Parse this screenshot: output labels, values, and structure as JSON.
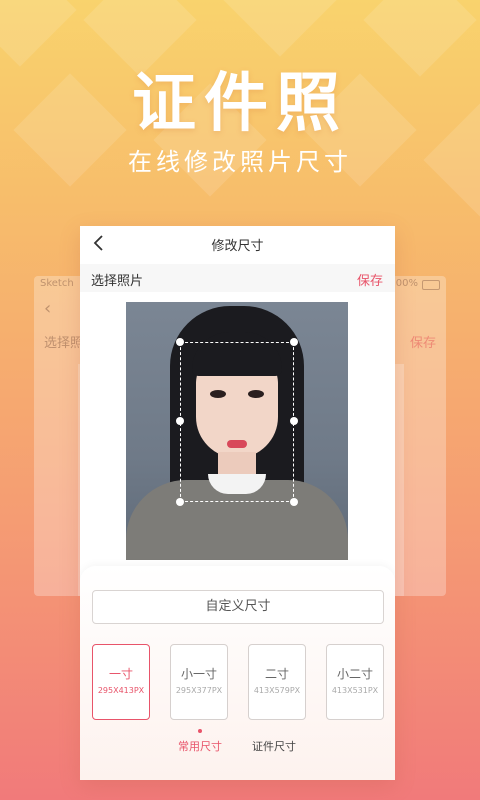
{
  "hero": {
    "title": "证件照",
    "subtitle": "在线修改照片尺寸"
  },
  "background_screen": {
    "status_left": "Sketch",
    "status_right": "100%",
    "left_label": "选择照",
    "right_label": "保存"
  },
  "screen": {
    "back_icon": "chevron-left-icon",
    "title": "修改尺寸",
    "select_photo": "选择照片",
    "save": "保存",
    "custom_size": "自定义尺寸",
    "sizes": [
      {
        "name": "一寸",
        "dims": "295X413PX",
        "active": true
      },
      {
        "name": "小一寸",
        "dims": "295X377PX",
        "active": false
      },
      {
        "name": "二寸",
        "dims": "413X579PX",
        "active": false
      },
      {
        "name": "小二寸",
        "dims": "413X531PX",
        "active": false
      }
    ],
    "tabs": {
      "common": "常用尺寸",
      "id": "证件尺寸"
    }
  },
  "colors": {
    "accent": "#e8546a",
    "bg_top": "#f9d36d",
    "bg_bottom": "#f17a7a"
  }
}
